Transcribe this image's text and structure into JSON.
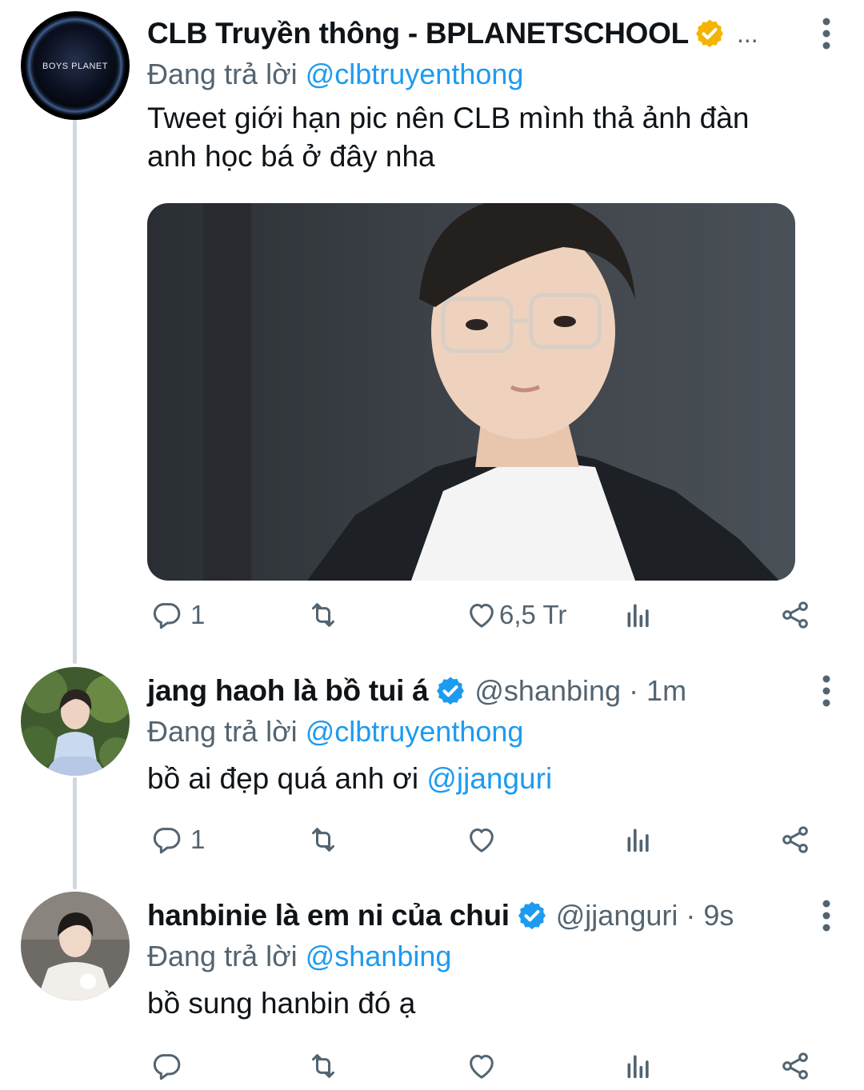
{
  "tweets": [
    {
      "name": "CLB Truyền thông - BPLANETSCHOOL",
      "verified": "gold",
      "ellipsis": "...",
      "replying_prefix": "Đang trả lời",
      "replying_to": "@clbtruyenthong",
      "text": "Tweet giới hạn pic nên CLB mình thả ảnh đàn anh học bá ở đây nha",
      "avatar_text": "BOYS PLANET",
      "actions": {
        "reply_count": "1",
        "retweet_count": "",
        "like_count": "6,5 Tr"
      }
    },
    {
      "name": "jang haoh là bồ tui á",
      "verified": "blue",
      "handle": "@shanbing",
      "time": "· 1m",
      "replying_prefix": "Đang trả lời",
      "replying_to": "@clbtruyenthong",
      "text": "bồ ai đẹp quá anh ơi",
      "text_mention": "@jjanguri",
      "actions": {
        "reply_count": "1",
        "retweet_count": "",
        "like_count": ""
      }
    },
    {
      "name": "hanbinie là em ni của chui",
      "verified": "blue",
      "handle": "@jjanguri",
      "time": "· 9s",
      "replying_prefix": "Đang trả lời",
      "replying_to": "@shanbing",
      "text": "bồ sung hanbin đó ạ",
      "actions": {
        "reply_count": "",
        "retweet_count": "",
        "like_count": ""
      }
    }
  ],
  "icons": [
    "reply-icon",
    "retweet-icon",
    "like-icon",
    "views-icon",
    "share-icon",
    "more-icon",
    "verified-badge-icon"
  ],
  "colors": {
    "accent": "#1d9bf0",
    "secondary_text": "#536471",
    "gold_badge": "#f4b400",
    "thread_line": "#cfd9de"
  }
}
